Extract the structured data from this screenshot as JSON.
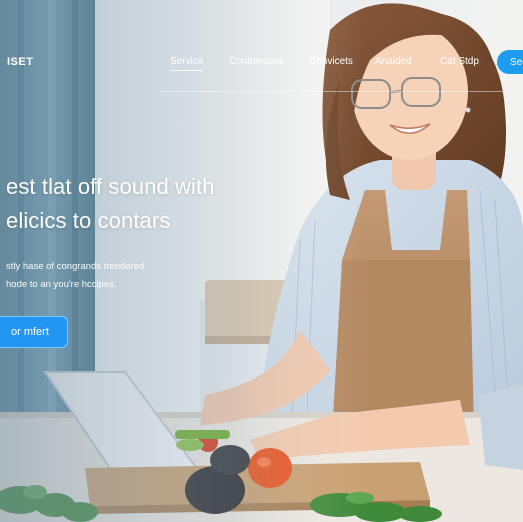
{
  "nav": {
    "brand": "ISET",
    "links": [
      {
        "label": "Service",
        "active": true
      },
      {
        "label": "Contnertons",
        "active": false
      },
      {
        "label": "Convicets",
        "active": false
      },
      {
        "label": "Anaided",
        "active": false
      },
      {
        "label": "Cat Stdp",
        "active": false
      }
    ],
    "cta_label": "Sec"
  },
  "hero": {
    "headline_line1": "est tlat off sound with",
    "headline_line2": "elicics to contars",
    "sub_line1": "stly hase of congrands trendared",
    "sub_line2": "hode to an you're hccipes.",
    "cta_label": "or mfert"
  },
  "colors": {
    "accent": "#2196f3",
    "nav_cta": "#1e9cf0"
  }
}
